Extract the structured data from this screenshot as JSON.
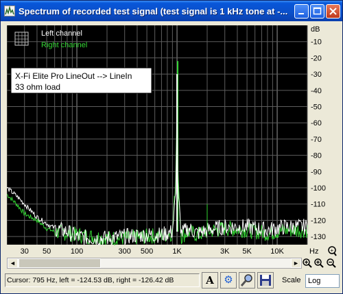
{
  "window": {
    "title": "Spectrum of recorded test signal (test signal is 1 kHz tone at -...",
    "buttons": {
      "minimize": "minimize",
      "maximize": "maximize",
      "close": "close"
    }
  },
  "legend": {
    "left": {
      "label": "Left channel",
      "color": "#ffffff"
    },
    "right": {
      "label": "Right channel",
      "color": "#33d633"
    }
  },
  "annotation": {
    "line1": "X-Fi Elite Pro  LineOut --> LineIn",
    "line2": "33 ohm load"
  },
  "axis": {
    "y_unit": "dB",
    "x_unit": "Hz"
  },
  "chart_data": {
    "type": "line",
    "title": "",
    "xlabel": "Hz",
    "ylabel": "dB",
    "x_scale": "log",
    "xlim": [
      20,
      20000
    ],
    "ylim": [
      -135,
      0
    ],
    "grid": true,
    "legend": "top-left",
    "x_ticks": [
      {
        "value": 30,
        "label": "30"
      },
      {
        "value": 50,
        "label": "50"
      },
      {
        "value": 100,
        "label": "100"
      },
      {
        "value": 300,
        "label": "300"
      },
      {
        "value": 500,
        "label": "500"
      },
      {
        "value": 1000,
        "label": "1K"
      },
      {
        "value": 3000,
        "label": "3K"
      },
      {
        "value": 5000,
        "label": "5K"
      },
      {
        "value": 10000,
        "label": "10K"
      }
    ],
    "y_ticks": [
      -10,
      -20,
      -30,
      -40,
      -50,
      -60,
      -70,
      -80,
      -90,
      -100,
      -110,
      -120,
      -130
    ],
    "series": [
      {
        "name": "Left channel",
        "color": "#ffffff",
        "x": [
          20,
          25,
          30,
          40,
          50,
          60,
          80,
          100,
          140,
          200,
          300,
          500,
          700,
          900,
          980,
          1000,
          1020,
          1100,
          1300,
          1600,
          2000,
          3000,
          5000,
          8000,
          12000,
          20000
        ],
        "y": [
          -100,
          -105,
          -110,
          -118,
          -122,
          -125,
          -127,
          -130,
          -131,
          -131,
          -130,
          -129,
          -129,
          -127,
          -100,
          -30,
          -100,
          -128,
          -125,
          -128,
          -126,
          -124,
          -124,
          -126,
          -124,
          -124
        ]
      },
      {
        "name": "Right channel",
        "color": "#33d633",
        "x": [
          20,
          25,
          30,
          40,
          50,
          60,
          80,
          100,
          140,
          200,
          300,
          500,
          700,
          900,
          980,
          1000,
          1020,
          1100,
          1300,
          1600,
          2000,
          3000,
          5000,
          8000,
          12000,
          20000
        ],
        "y": [
          -104,
          -110,
          -116,
          -120,
          -125,
          -127,
          -128,
          -129,
          -130,
          -131,
          -131,
          -130,
          -129,
          -128,
          -90,
          -22,
          -90,
          -130,
          -127,
          -129,
          -127,
          -125,
          -126,
          -128,
          -126,
          -126
        ]
      }
    ]
  },
  "scrollbar": {
    "left_arrow": "◄",
    "right_arrow": "►"
  },
  "zoom": {
    "zoom_in_y": "+",
    "zoom_in": "+",
    "zoom_out": "−"
  },
  "status": {
    "cursor": "Cursor:  795 Hz,  left = -124.53 dB,  right = -126.42 dB"
  },
  "toolbar": {
    "font_btn": "A",
    "settings_btn": "⚙",
    "search_btn": "🔍",
    "save_btn": "💾"
  },
  "scale": {
    "label": "Scale",
    "value": "Log"
  }
}
